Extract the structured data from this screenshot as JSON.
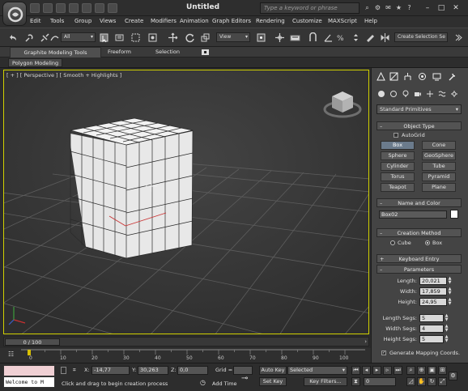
{
  "window": {
    "title": "Untitled",
    "search_placeholder": "Type a keyword or phrase"
  },
  "menu": {
    "items": [
      "Edit",
      "Tools",
      "Group",
      "Views",
      "Create",
      "Modifiers",
      "Animation",
      "Graph Editors",
      "Rendering",
      "Customize",
      "MAXScript",
      "Help"
    ]
  },
  "toolbar": {
    "selection_filter": "All",
    "reference_coord": "View",
    "named_selection": "Create Selection Se"
  },
  "ribbon": {
    "tabs": [
      "Graphite Modeling Tools",
      "Freeform",
      "Selection"
    ],
    "subtab": "Polygon Modeling"
  },
  "viewport": {
    "label": "[ + ] [ Perspective ] [ Smooth + Highlights ]",
    "colors": {
      "background": "#3b3b3b",
      "grid": "#5a5a5a",
      "box_face": "#e8e8e8",
      "box_wire": "#2a2a2a",
      "active_border": "#d0d000"
    }
  },
  "command_panel": {
    "category": "Standard Primitives",
    "object_type": {
      "title": "Object Type",
      "autogrid_label": "AutoGrid",
      "buttons": [
        "Box",
        "Cone",
        "Sphere",
        "GeoSphere",
        "Cylinder",
        "Tube",
        "Torus",
        "Pyramid",
        "Teapot",
        "Plane"
      ],
      "active": "Box"
    },
    "name_color": {
      "title": "Name and Color",
      "name": "Box02",
      "swatch_color": "#ffffff"
    },
    "creation_method": {
      "title": "Creation Method",
      "options": [
        "Cube",
        "Box"
      ],
      "selected": "Box"
    },
    "keyboard_entry": {
      "title": "Keyboard Entry"
    },
    "parameters": {
      "title": "Parameters",
      "length_label": "Length:",
      "length": "20,021",
      "width_label": "Width:",
      "width": "17,859",
      "height_label": "Height:",
      "height": "24,95",
      "length_segs_label": "Length Segs:",
      "length_segs": "5",
      "width_segs_label": "Width Segs:",
      "width_segs": "4",
      "height_segs_label": "Height Segs:",
      "height_segs": "5",
      "gen_mapping_label": "Generate Mapping Coords.",
      "gen_mapping_checked": true
    }
  },
  "timeline": {
    "frame_display": "0 / 100",
    "ticks": [
      "0",
      "10",
      "20",
      "30",
      "40",
      "50",
      "60",
      "70",
      "80",
      "90",
      "100"
    ]
  },
  "status": {
    "maxscript_listener": "Welcome to M",
    "prompt": "Click and drag to begin creation process",
    "x_label": "X:",
    "x_value": "-14,77",
    "y_label": "Y:",
    "y_value": "30,263",
    "z_label": "Z:",
    "z_value": "0,0",
    "grid_label": "Grid =",
    "grid_value": "",
    "add_time_label": "Add Time",
    "auto_key_label": "Auto Key",
    "auto_key_mode": "Selected",
    "set_key_label": "Set Key",
    "key_filters_label": "Key Filters...",
    "current_frame": "0"
  }
}
